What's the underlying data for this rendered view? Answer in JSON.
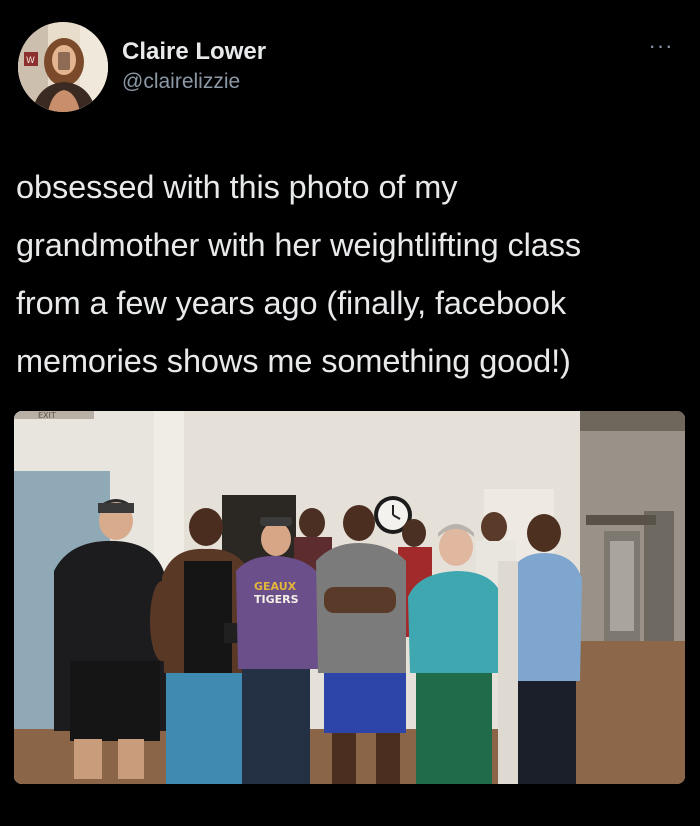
{
  "author": {
    "display_name": "Claire Lower",
    "handle": "@clairelizzie",
    "avatar_icon": "profile-photo"
  },
  "more_icon": "more-options-icon",
  "more_glyph": "···",
  "tweet": {
    "text": "obsessed with this photo of my\ngrandmother with her weightlifting class\nfrom a few years ago (finally, facebook\nmemories shows me something good!)"
  },
  "photo": {
    "sign_text": "EXIT",
    "shirt_text_1": "GEAUX",
    "shirt_text_2": "TIGERS"
  },
  "colors": {
    "background": "#000000",
    "primary_text": "#e7e9ea",
    "secondary_text": "#8b98a5"
  }
}
